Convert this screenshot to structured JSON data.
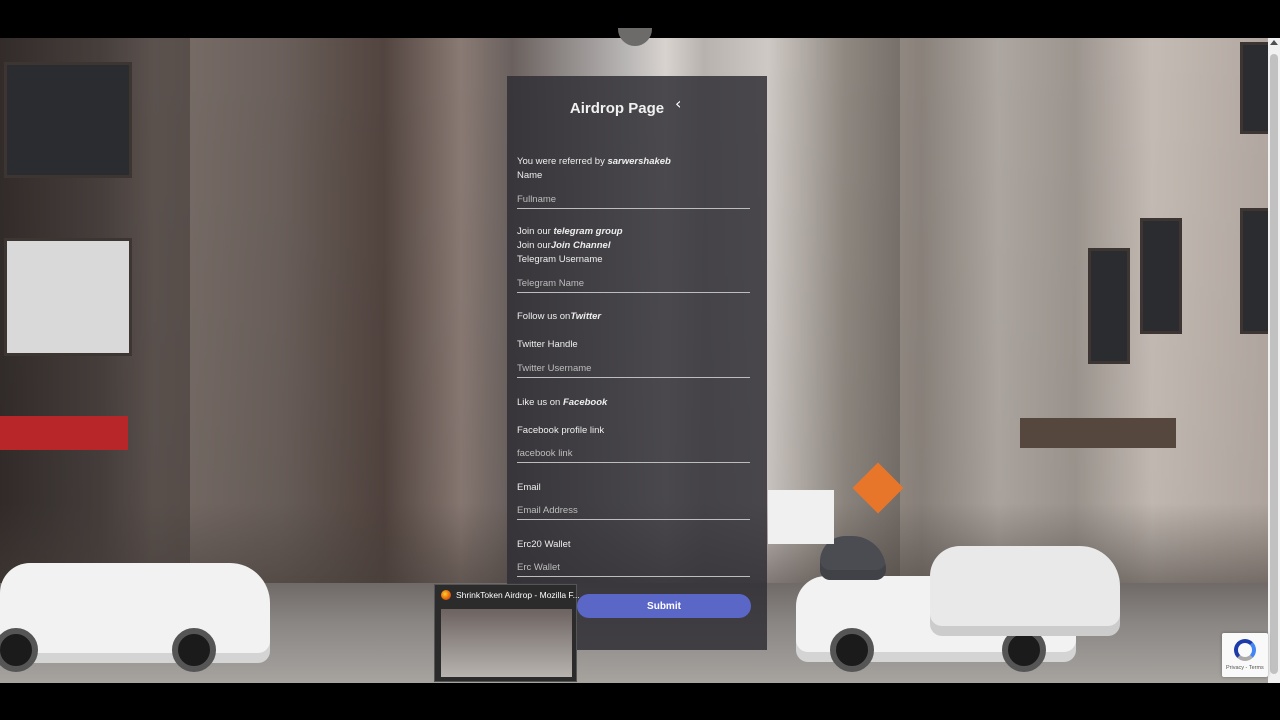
{
  "form": {
    "title": "Airdrop Page",
    "referral_prefix": "You were referred by ",
    "referrer": "sarwershakeb",
    "name_label": "Name",
    "name_placeholder": "Fullname",
    "telegram_join_group_prefix": "Join our ",
    "telegram_group_link": "telegram group",
    "telegram_join_channel_prefix": "Join our",
    "telegram_channel_link": "Join Channel",
    "telegram_label": "Telegram Username",
    "telegram_placeholder": "Telegram Name",
    "twitter_follow_prefix": "Follow us on",
    "twitter_link": "Twitter",
    "twitter_label": "Twitter Handle",
    "twitter_placeholder": "Twitter Username",
    "facebook_like_prefix": "Like us on ",
    "facebook_link": "Facebook",
    "facebook_label": "Facebook profile link",
    "facebook_placeholder": "facebook link",
    "email_label": "Email",
    "email_placeholder": "Email Address",
    "wallet_label": "Erc20 Wallet",
    "wallet_placeholder": "Erc Wallet",
    "submit_label": "Submit"
  },
  "taskbar_preview": {
    "title": "ShrinkToken Airdrop - Mozilla F..."
  },
  "recaptcha": {
    "terms": "Privacy - Terms"
  },
  "colors": {
    "submit": "#5b67c7",
    "panel": "rgba(48,46,52,0.84)"
  }
}
